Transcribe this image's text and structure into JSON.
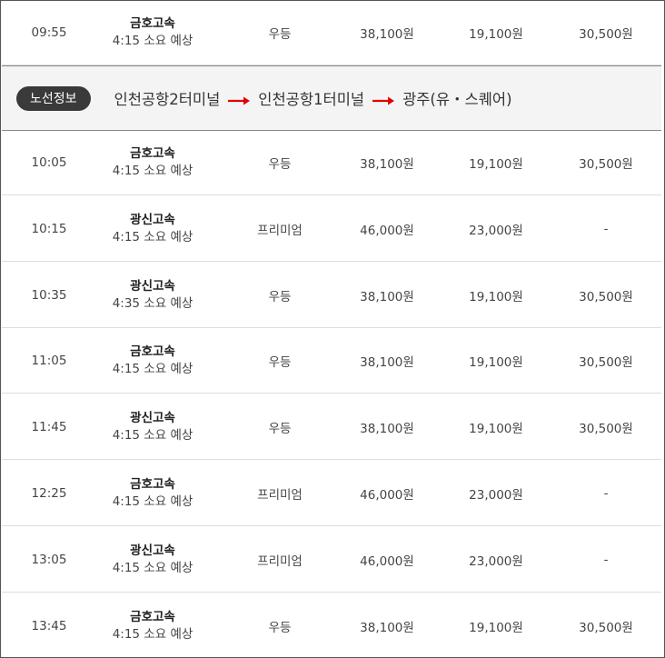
{
  "route": {
    "badge": "노선정보",
    "stops": [
      "인천공항2터미널",
      "인천공항1터미널",
      "광주(유・스퀘어)"
    ],
    "arrow_color": "#e00000"
  },
  "rows": [
    {
      "time": "09:55",
      "company": "금호고속",
      "duration": "4:15 소요 예상",
      "grade": "우등",
      "adult": "38,100원",
      "child": "19,100원",
      "adult2": "30,500원"
    },
    {
      "time": "10:05",
      "company": "금호고속",
      "duration": "4:15 소요 예상",
      "grade": "우등",
      "adult": "38,100원",
      "child": "19,100원",
      "adult2": "30,500원"
    },
    {
      "time": "10:15",
      "company": "광신고속",
      "duration": "4:15 소요 예상",
      "grade": "프리미엄",
      "adult": "46,000원",
      "child": "23,000원",
      "adult2": "-"
    },
    {
      "time": "10:35",
      "company": "광신고속",
      "duration": "4:35 소요 예상",
      "grade": "우등",
      "adult": "38,100원",
      "child": "19,100원",
      "adult2": "30,500원"
    },
    {
      "time": "11:05",
      "company": "금호고속",
      "duration": "4:15 소요 예상",
      "grade": "우등",
      "adult": "38,100원",
      "child": "19,100원",
      "adult2": "30,500원"
    },
    {
      "time": "11:45",
      "company": "광신고속",
      "duration": "4:15 소요 예상",
      "grade": "우등",
      "adult": "38,100원",
      "child": "19,100원",
      "adult2": "30,500원"
    },
    {
      "time": "12:25",
      "company": "금호고속",
      "duration": "4:15 소요 예상",
      "grade": "프리미엄",
      "adult": "46,000원",
      "child": "23,000원",
      "adult2": "-"
    },
    {
      "time": "13:05",
      "company": "광신고속",
      "duration": "4:15 소요 예상",
      "grade": "프리미엄",
      "adult": "46,000원",
      "child": "23,000원",
      "adult2": "-"
    },
    {
      "time": "13:45",
      "company": "금호고속",
      "duration": "4:15 소요 예상",
      "grade": "우등",
      "adult": "38,100원",
      "child": "19,100원",
      "adult2": "30,500원"
    }
  ]
}
